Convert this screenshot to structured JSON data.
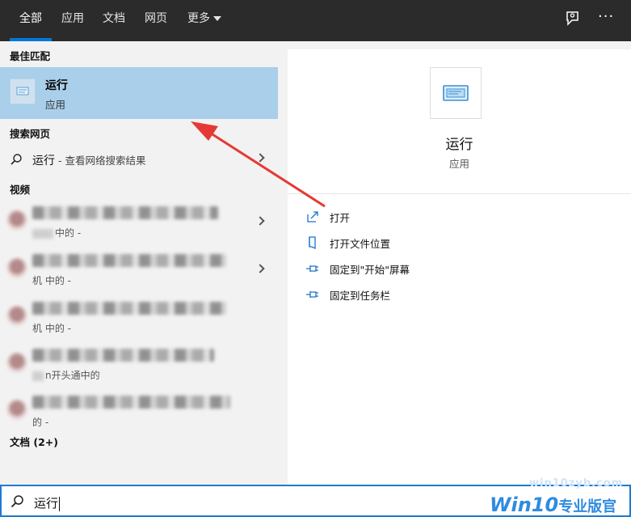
{
  "tabs": [
    {
      "label": "全部"
    },
    {
      "label": "应用"
    },
    {
      "label": "文档"
    },
    {
      "label": "网页"
    },
    {
      "label": "更多"
    }
  ],
  "top_icons": {
    "feedback": "feedback-icon",
    "more": "···"
  },
  "left": {
    "best_match_title": "最佳匹配",
    "best_match": {
      "title": "运行",
      "subtitle": "应用"
    },
    "web_title": "搜索网页",
    "web_item": {
      "query": "运行",
      "suffix": " - 查看网络搜索结果"
    },
    "videos_title": "视频",
    "videos": [
      {
        "sub": "中的 -"
      },
      {
        "sub": "机 中的 -"
      },
      {
        "sub": "机 中的 -"
      },
      {
        "sub": "n开头通中的"
      },
      {
        "sub": "的 -"
      }
    ],
    "docs_title": "文档 (2+)"
  },
  "right": {
    "title": "运行",
    "subtitle": "应用",
    "actions": [
      {
        "label": "打开",
        "icon": "open-icon"
      },
      {
        "label": "打开文件位置",
        "icon": "file-location-icon"
      },
      {
        "label": "固定到\"开始\"屏幕",
        "icon": "pin-icon"
      },
      {
        "label": "固定到任务栏",
        "icon": "pin-icon"
      }
    ]
  },
  "search": {
    "value": "运行"
  },
  "watermark": {
    "small": "win10zyb.com",
    "brand": "Win10",
    "cn": "专业版官网"
  },
  "colors": {
    "accent": "#0078d7",
    "selection": "#a9cfea",
    "topbar": "#2b2b2b",
    "arrow": "#e53935"
  }
}
